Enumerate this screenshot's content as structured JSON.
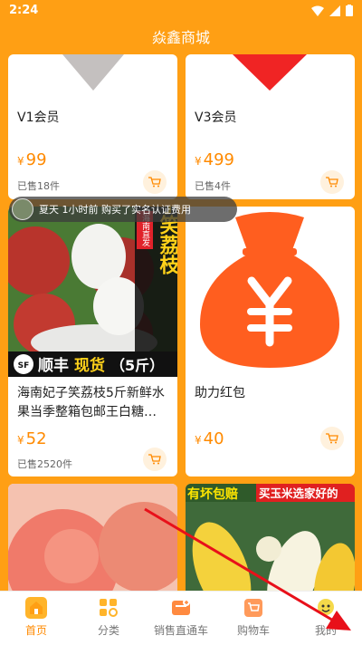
{
  "status": {
    "time": "2:24"
  },
  "app": {
    "title": "焱鑫商城"
  },
  "products": [
    {
      "name": "V1会员",
      "price": "99",
      "sold": "已售18件"
    },
    {
      "name": "V3会员",
      "price": "499",
      "sold": "已售4件"
    },
    {
      "name": "海南妃子笑荔枝5斤新鲜水果当季整箱包邮王白糖…",
      "price": "52",
      "sold": "已售2520件",
      "img_text": {
        "tag": "海南直发",
        "vertical": "妃子笑荔枝",
        "bottom_a": "顺丰",
        "bottom_b": "现货",
        "bottom_c": "（5斤）",
        "logo": "SF"
      }
    },
    {
      "name": "助力红包",
      "price": "40",
      "sold": ""
    },
    {
      "img_text": {
        "left": "",
        "right": ""
      }
    },
    {
      "img_text": {
        "left": "有坏包赔",
        "right": "买玉米选家好的"
      }
    }
  ],
  "currency": "¥",
  "toast": {
    "text": "夏天 1小时前 购买了实名认证费用"
  },
  "tabbar": [
    {
      "label": "首页",
      "icon": "home-icon"
    },
    {
      "label": "分类",
      "icon": "category-icon"
    },
    {
      "label": "销售直通车",
      "icon": "sales-icon"
    },
    {
      "label": "购物车",
      "icon": "cart-icon"
    },
    {
      "label": "我的",
      "icon": "profile-icon"
    }
  ],
  "colors": {
    "brand": "#ff9f14",
    "accent": "#ff8a00",
    "red": "#f02424",
    "money_bag": "#ff5e1f"
  }
}
